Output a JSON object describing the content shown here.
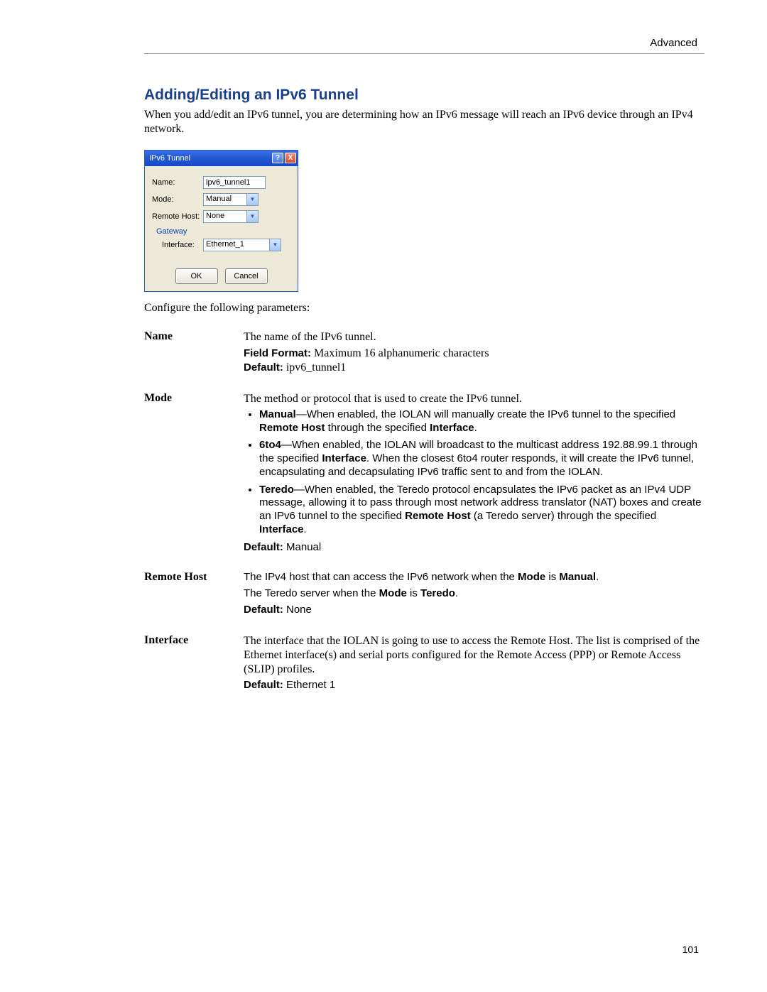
{
  "header": {
    "section": "Advanced"
  },
  "title": "Adding/Editing an IPv6 Tunnel",
  "intro": "When you add/edit an IPv6 tunnel, you are determining how an IPv6 message will reach an IPv6 device through an IPv4 network.",
  "dialog": {
    "titlebar": "IPv6 Tunnel",
    "help_glyph": "?",
    "close_glyph": "X",
    "labels": {
      "name": "Name:",
      "mode": "Mode:",
      "remote_host": "Remote Host:",
      "gateway": "Gateway",
      "interface": "Interface:"
    },
    "values": {
      "name": "ipv6_tunnel1",
      "mode": "Manual",
      "remote_host": "None",
      "interface": "Ethernet_1"
    },
    "buttons": {
      "ok": "OK",
      "cancel": "Cancel"
    },
    "arrow": "▼"
  },
  "configure_line": "Configure the following parameters:",
  "params": {
    "name": {
      "label": "Name",
      "line1": "The name of the IPv6 tunnel.",
      "ff_label": "Field Format:",
      "ff_text": " Maximum 16 alphanumeric characters",
      "def_label": "Default:",
      "def_text": " ipv6_tunnel1"
    },
    "mode": {
      "label": "Mode",
      "line1": "The method or protocol that is used to create the IPv6 tunnel.",
      "b_manual_bold": "Manual",
      "b_manual_rest": "—When enabled, the IOLAN will manually create the IPv6 tunnel to the specified ",
      "b_manual_rh": "Remote Host",
      "b_manual_mid": " through the specified ",
      "b_manual_if": "Interface",
      "b_manual_end": ".",
      "b_6to4_bold": "6to4",
      "b_6to4_rest": "—When enabled, the IOLAN will broadcast to the multicast address 192.88.99.1 through the specified ",
      "b_6to4_if": "Interface",
      "b_6to4_end": ". When the closest 6to4 router responds, it will create the IPv6 tunnel, encapsulating and decapsulating IPv6 traffic sent to and from the IOLAN.",
      "b_teredo_bold": "Teredo",
      "b_teredo_rest": "—When enabled, the Teredo protocol encapsulates the IPv6 packet as an IPv4 UDP message, allowing it to pass through most network address translator (NAT) boxes and create an IPv6 tunnel to the specified ",
      "b_teredo_rh": "Remote Host",
      "b_teredo_mid": " (a Teredo server) through the specified ",
      "b_teredo_if": "Interface",
      "b_teredo_end": ".",
      "def_label": "Default:",
      "def_text": " Manual"
    },
    "remote_host": {
      "label": "Remote Host",
      "line1a": "The IPv4 host that can access the IPv6 network when the ",
      "line1_mode": "Mode",
      "line1_mid": " is ",
      "line1_manual": "Manual",
      "line1_end": ".",
      "line2a": "The Teredo server when the ",
      "line2_mode": "Mode",
      "line2_mid": " is ",
      "line2_teredo": "Teredo",
      "line2_end": ".",
      "def_label": "Default:",
      "def_text": " None"
    },
    "interface": {
      "label": "Interface",
      "line1": "The interface that the IOLAN is going to use to access the Remote Host. The list is comprised of the Ethernet interface(s) and serial ports configured for the Remote Access (PPP) or Remote Access (SLIP) profiles.",
      "def_label": "Default:",
      "def_text": " Ethernet 1"
    }
  },
  "page_number": "101"
}
